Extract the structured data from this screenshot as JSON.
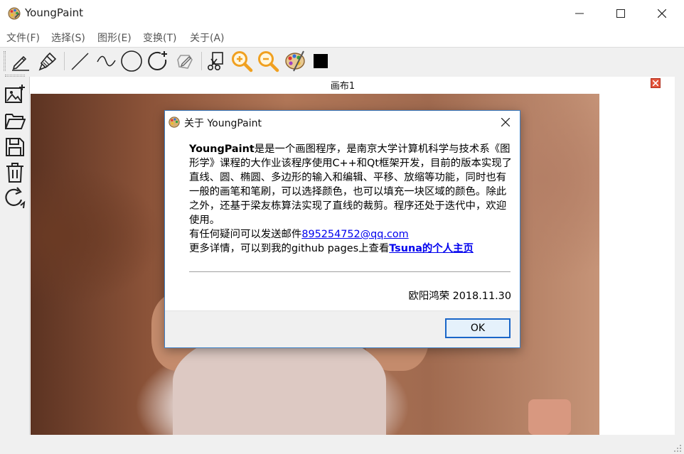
{
  "window": {
    "title": "YoungPaint"
  },
  "menu": [
    {
      "label": "文件(F)"
    },
    {
      "label": "选择(S)"
    },
    {
      "label": "图形(E)"
    },
    {
      "label": "变换(T)"
    },
    {
      "label": "关于(A)"
    }
  ],
  "toolbar": {
    "tools": [
      "pencil-icon",
      "brush-icon",
      "line-icon",
      "curve-icon",
      "circle-icon",
      "polygon-icon",
      "fill-icon",
      "clip-icon",
      "zoom-in-icon",
      "zoom-out-icon",
      "palette-icon",
      "color-swatch"
    ],
    "current_color": "#000000"
  },
  "side_toolbar": [
    "new-canvas-icon",
    "open-folder-icon",
    "save-icon",
    "delete-icon",
    "rotate-icon"
  ],
  "document": {
    "tab_title": "画布1"
  },
  "about_dialog": {
    "title": "关于 YoungPaint",
    "app_name": "YoungPaint",
    "description": "是是一个画图程序，是南京大学计算机科学与技术系《图形学》课程的大作业该程序使用C++和Qt框架开发，目前的版本实现了直线、圆、椭圆、多边形的输入和编辑、平移、放缩等功能，同时也有一般的画笔和笔刷，可以选择颜色，也可以填充一块区域的颜色。除此之外，还基于梁友栋算法实现了直线的裁剪。程序还处于迭代中，欢迎使用。",
    "contact_prefix": "有任何疑问可以发送邮件",
    "email": "895254752@qq.com",
    "more_prefix": "更多详情，可以到我的github pages上查看",
    "homepage_link": "Tsuna的个人主页",
    "signature": "欧阳鸿荣 2018.11.30",
    "ok_label": "OK"
  },
  "colors": {
    "accent": "#3c7fc6",
    "link": "#0000ee",
    "close_red": "#e3553c",
    "zoom_orange": "#f0a020"
  }
}
